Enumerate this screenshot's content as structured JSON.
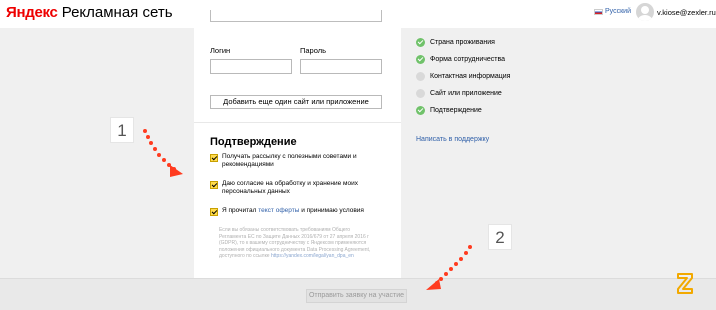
{
  "header": {
    "logo_brand": "Яндекс",
    "logo_rest": "Рекламная сеть",
    "language": "Русский",
    "user_email": "v.kiose@zexler.ru"
  },
  "form": {
    "login_label": "Логин",
    "login_value": "",
    "password_label": "Пароль",
    "password_value": "",
    "add_site_button": "Добавить еще один сайт или приложение",
    "confirmation_title": "Подтверждение",
    "checkboxes": [
      {
        "text": "Получать рассылку с полезными советами и рекомендациями",
        "checked": true
      },
      {
        "text": "Даю согласие на обработку и хранение моих персональных данных",
        "checked": true
      },
      {
        "text_before": "Я прочитал ",
        "link": "текст оферты",
        "text_after": " и принимаю условия",
        "checked": true
      }
    ],
    "legal_text": "Если вы обязаны соответствовать требованиям Общего Регламента ЕС по Защите Данных 2016/679 от 27 апреля 2016 г (GDPR), то к вашему сотрудничеству с Яндексом применяются положения официального документа Data Processing Agreement, доступного по ссылке",
    "legal_link": "https://yandex.com/legal/yan_dpa_en"
  },
  "steps": [
    {
      "label": "Страна проживания",
      "status": "done"
    },
    {
      "label": "Форма сотрудничества",
      "status": "done"
    },
    {
      "label": "Контактная информация",
      "status": "pending"
    },
    {
      "label": "Сайт или приложение",
      "status": "pending"
    },
    {
      "label": "Подтверждение",
      "status": "done"
    }
  ],
  "support_link": "Написать в поддержку",
  "submit_button": "Отправить заявку на участие",
  "annotations": {
    "marker_1": "1",
    "marker_2": "2",
    "arrow_color": "#ff3b1f"
  },
  "colors": {
    "accent_yellow": "#ffdb4d",
    "step_done": "#70c26a",
    "link": "#2f5fa8",
    "yandex_red": "#ee0000"
  }
}
